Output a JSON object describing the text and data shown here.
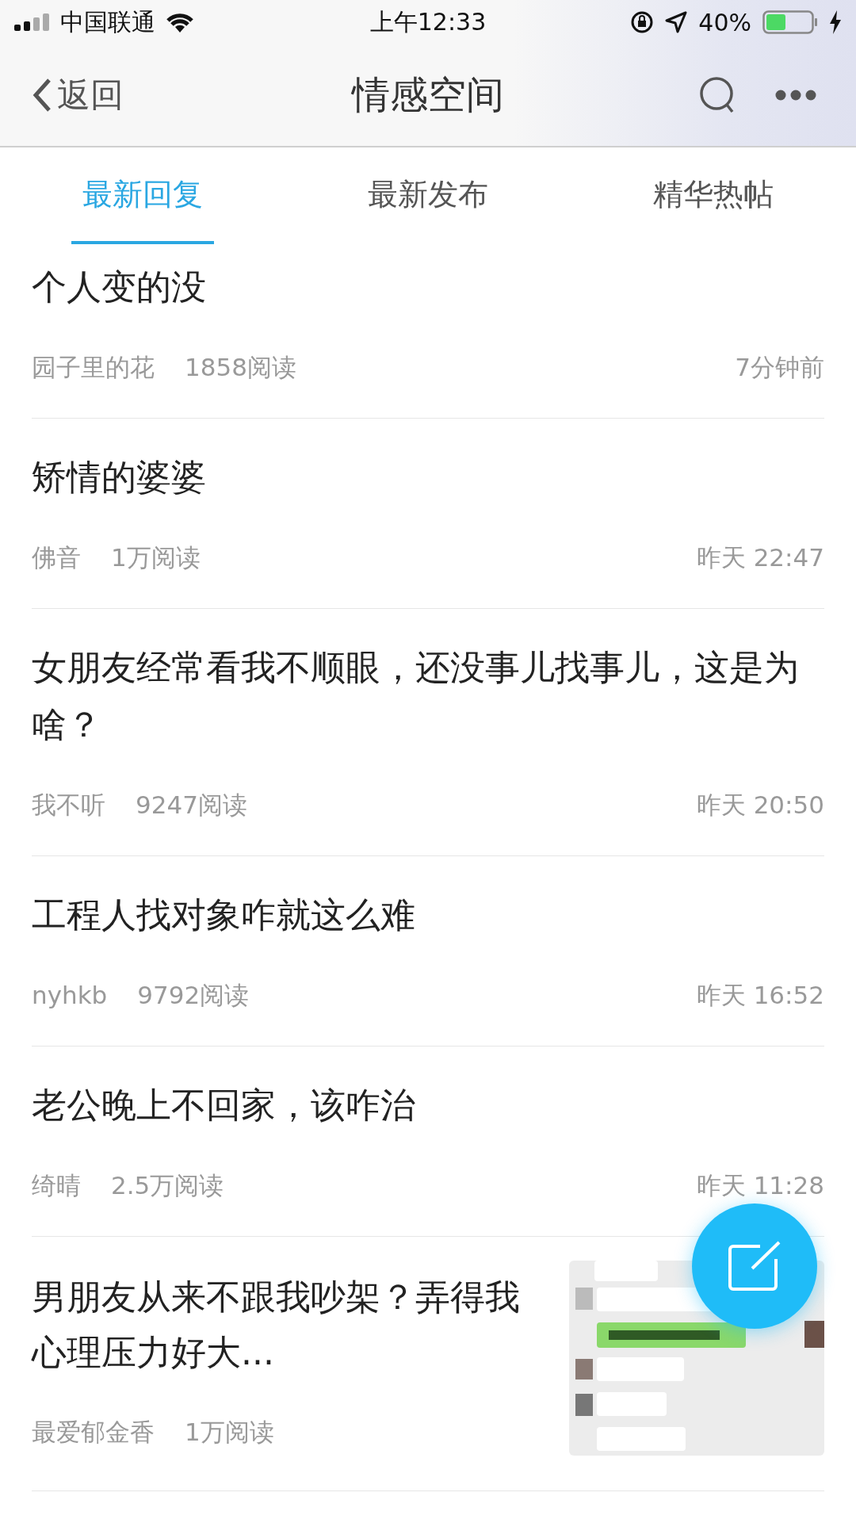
{
  "status_bar": {
    "carrier": "中国联通",
    "time": "上午12:33",
    "battery": "40%"
  },
  "nav": {
    "back": "返回",
    "title": "情感空间"
  },
  "tabs": [
    {
      "label": "最新回复",
      "selected": true
    },
    {
      "label": "最新发布",
      "selected": false
    },
    {
      "label": "精华热帖",
      "selected": false
    }
  ],
  "posts": [
    {
      "title": "个人变的没",
      "author": "园子里的花",
      "reads": "1858阅读",
      "time": "7分钟前"
    },
    {
      "title": "矫情的婆婆",
      "author": "佛音",
      "reads": "1万阅读",
      "time": "昨天 22:47"
    },
    {
      "title": "女朋友经常看我不顺眼，还没事儿找事儿，这是为啥？",
      "author": "我不听",
      "reads": "9247阅读",
      "time": "昨天 20:50"
    },
    {
      "title": "工程人找对象咋就这么难",
      "author": "nyhkb",
      "reads": "9792阅读",
      "time": "昨天 16:52"
    },
    {
      "title": "老公晚上不回家，该咋治",
      "author": "绮晴",
      "reads": "2.5万阅读",
      "time": "昨天 11:28"
    },
    {
      "title": "男朋友从来不跟我吵架？弄得我心理压力好大...",
      "author": "最爱郁金香",
      "reads": "1万阅读"
    }
  ]
}
